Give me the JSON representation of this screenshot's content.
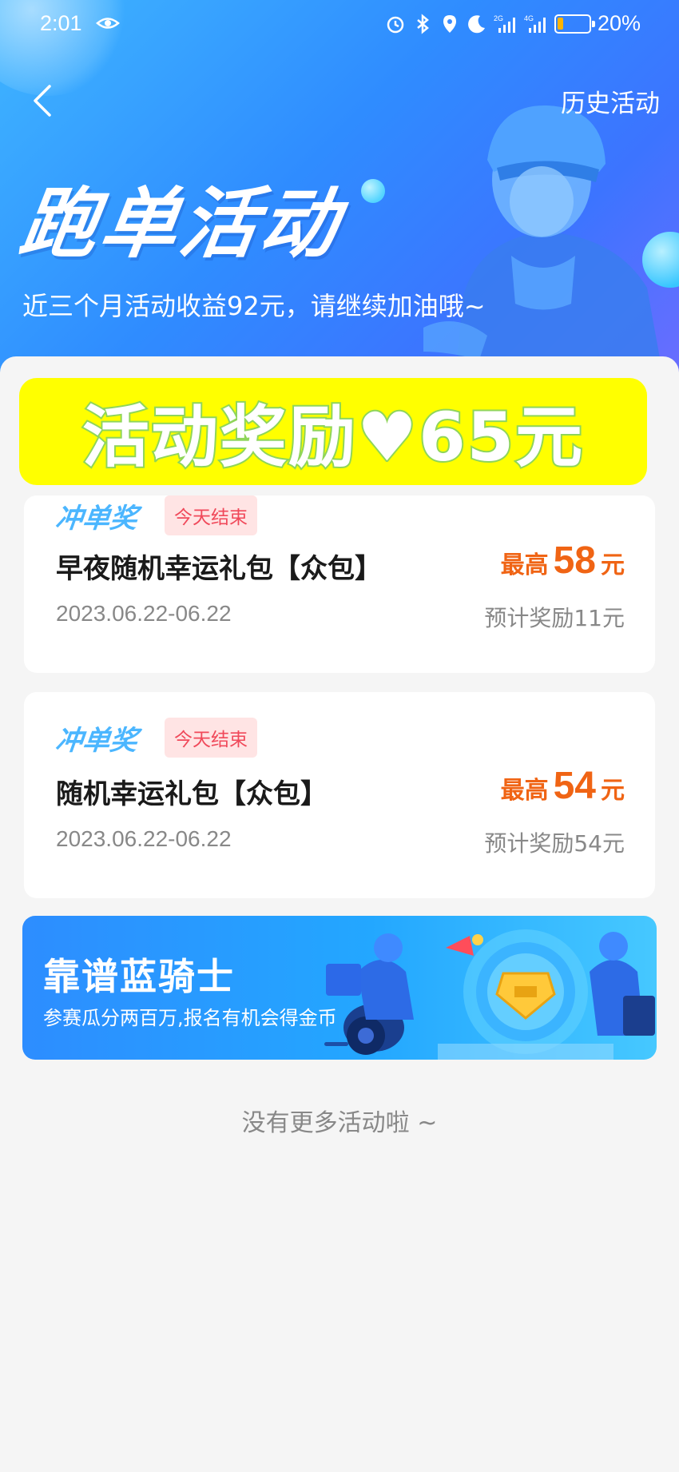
{
  "status_bar": {
    "time": "2:01",
    "battery_percent": "20%",
    "battery_level": 0.2,
    "network_labels": [
      "2G",
      "4G"
    ]
  },
  "header": {
    "back_icon": "chevron-left-icon",
    "history_label": "历史活动"
  },
  "hero": {
    "title": "跑单活动",
    "subtitle": "近三个月活动收益92元，请继续加油哦~"
  },
  "highlight_banner": {
    "text": "活动奖励♥65元",
    "background": "#ffff00"
  },
  "rewards": [
    {
      "type_label": "冲单奖",
      "end_badge": "今天结束",
      "title": "早夜随机幸运礼包【众包】",
      "date_range": "2023.06.22-06.22",
      "max_prefix": "最高",
      "max_amount": "58",
      "max_unit": "元",
      "estimate": "预计奖励11元"
    },
    {
      "type_label": "冲单奖",
      "end_badge": "今天结束",
      "title": "随机幸运礼包【众包】",
      "date_range": "2023.06.22-06.22",
      "max_prefix": "最高",
      "max_amount": "54",
      "max_unit": "元",
      "estimate": "预计奖励54元"
    }
  ],
  "promo": {
    "title": "靠谱蓝骑士",
    "subtitle": "参赛瓜分两百万,报名有机会得金币"
  },
  "footer": {
    "no_more": "没有更多活动啦 ~"
  },
  "colors": {
    "accent_orange": "#f06414",
    "badge_red": "#f0495a",
    "type_blue": "#4bb6ff",
    "hero_blue": "#2f8cff"
  }
}
